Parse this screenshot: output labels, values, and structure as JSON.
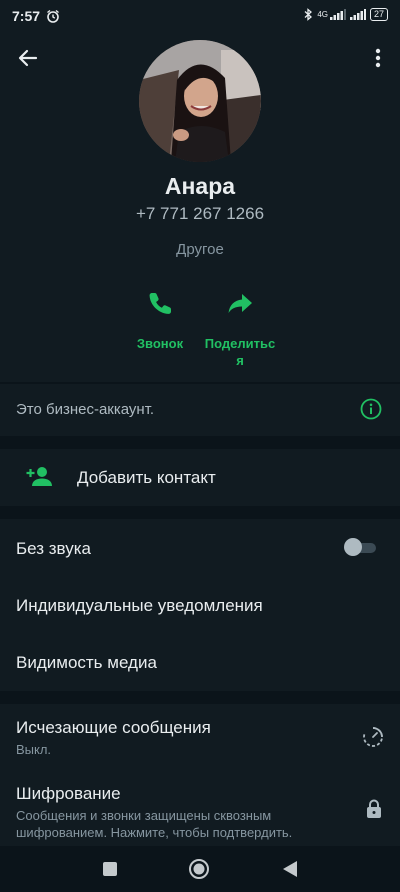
{
  "status_bar": {
    "time": "7:57",
    "network": "4G",
    "battery": "27"
  },
  "contact": {
    "name": "Анара",
    "phone": "+7 771 267 1266",
    "label": "Другое"
  },
  "actions": [
    {
      "label": "Звонок",
      "icon": "phone-icon"
    },
    {
      "label": "Поделиться",
      "icon": "share-icon"
    }
  ],
  "business_notice": "Это бизнес-аккаунт.",
  "add_contact": "Добавить контакт",
  "settings": {
    "mute": "Без звука",
    "mute_enabled": false,
    "custom_notifications": "Индивидуальные уведомления",
    "media_visibility": "Видимость медиа"
  },
  "disappearing": {
    "title": "Исчезающие сообщения",
    "value": "Выкл."
  },
  "encryption": {
    "title": "Шифрование",
    "description": "Сообщения и звонки защищены сквозным шифрованием. Нажмите, чтобы подтвердить."
  },
  "colors": {
    "accent": "#21c063",
    "background": "#0b141a",
    "surface": "#111b21"
  }
}
